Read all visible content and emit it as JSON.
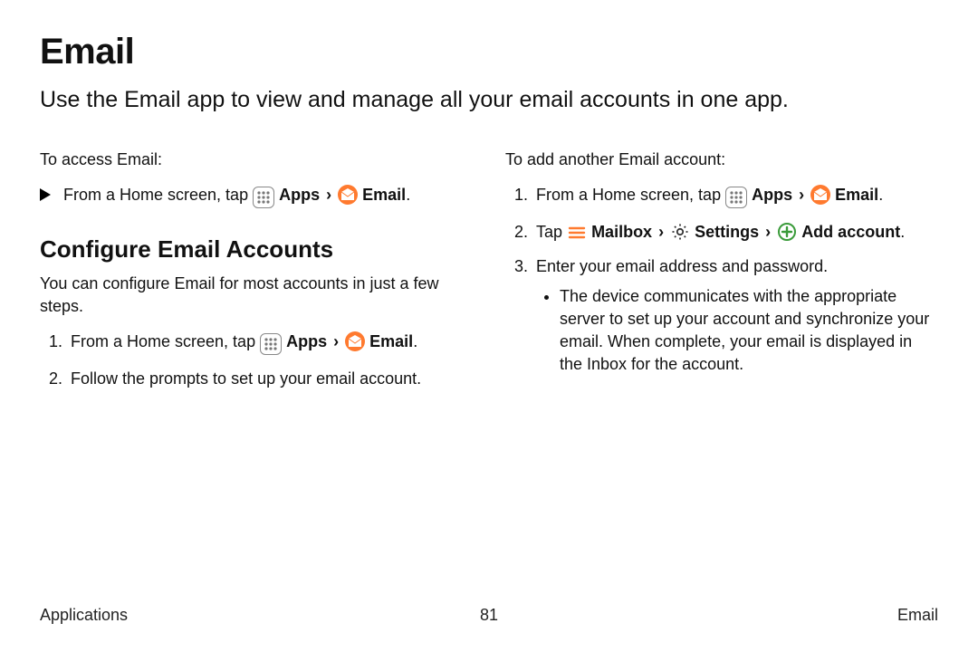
{
  "title": "Email",
  "subtitle": "Use the Email app to view and manage all your email accounts in one app.",
  "left": {
    "intro": "To access Email:",
    "access_prefix": "From a Home screen, tap",
    "apps": "Apps",
    "sep": "›",
    "email": "Email",
    "period": ".",
    "section": "Configure Email Accounts",
    "section_desc": "You can configure Email for most accounts in just a few steps.",
    "step1_prefix": "From a Home screen, tap",
    "step2": "Follow the prompts to set up your email account."
  },
  "right": {
    "intro": "To add another Email account:",
    "step1_prefix": "From a Home screen, tap",
    "apps": "Apps",
    "sep": "›",
    "email": "Email",
    "period": ".",
    "step2_tap": "Tap",
    "mailbox": "Mailbox",
    "settings": "Settings",
    "addaccount": "Add account",
    "step3": "Enter your email address and password.",
    "sub_bullet": "The device communicates with the appropriate server to set up your account and synchronize your email. When complete, your email is displayed in the Inbox for the account."
  },
  "footer": {
    "left": "Applications",
    "center": "81",
    "right": "Email"
  }
}
